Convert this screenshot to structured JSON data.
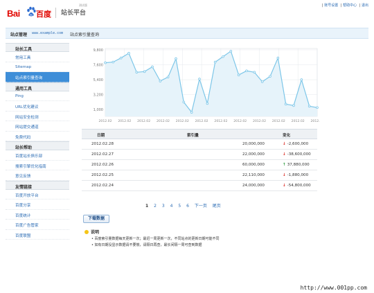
{
  "header": {
    "logo_bai": "Bai",
    "logo_du": "百度",
    "brand": "站长平台",
    "beta": "测试版",
    "toplinks": [
      "账号设置",
      "帮助中心",
      "退出"
    ],
    "sep": "|"
  },
  "titlebar": {
    "section": "站点管理",
    "site": "www.example.com",
    "page": "站点索引量查询"
  },
  "sidebar": {
    "groups": [
      {
        "title": "站长工具",
        "items": [
          "常用工具",
          "Sitemap",
          "站点索引量查询"
        ]
      },
      {
        "title": "通用工具",
        "items": [
          "Ping",
          "URL优化建议",
          "网站安全检测",
          "网站提交通道",
          "免费代码"
        ]
      },
      {
        "title": "站长帮助",
        "items": [
          "百度站长俱乐部",
          "搜索引擎优化指南",
          "意见反馈"
        ]
      },
      {
        "title": "友情链接",
        "items": [
          "百度开放平台",
          "百度分享",
          "百度统计",
          "百度广告管家",
          "百度联盟"
        ]
      }
    ]
  },
  "chart_data": {
    "type": "line",
    "ylim": [
      0,
      10000
    ],
    "yticks": [
      "1,000",
      "3,200",
      "5,400",
      "7,600",
      "9,800"
    ],
    "xticks": [
      "2012.02",
      "2012.02",
      "2012.02",
      "2012.02",
      "2012.02",
      "2012.02",
      "2012.02",
      "2012.02",
      "2012.02",
      "2012.02",
      "2012.02",
      "2012.02"
    ],
    "series": [
      {
        "values": [
          7900,
          8000,
          8600,
          9300,
          6500,
          6600,
          7300,
          5200,
          5800,
          8500,
          2100,
          600,
          5500,
          1900,
          8000,
          8800,
          9600,
          6100,
          6700,
          6500,
          5100,
          5900,
          8600,
          1800,
          1600,
          5400,
          1500,
          1300
        ]
      }
    ],
    "color": "#7cc6e8",
    "fill": "#e6f3fa",
    "grid": true
  },
  "table": {
    "headers": [
      "日期",
      "索引量",
      "变化"
    ],
    "rows": [
      {
        "date": "2012.02.28",
        "index": "20,000,000",
        "dir": "down",
        "change": "-2,600,000"
      },
      {
        "date": "2012.02.27",
        "index": "22,000,000",
        "dir": "down",
        "change": "-38,600,000"
      },
      {
        "date": "2012.02.26",
        "index": "60,000,000",
        "dir": "up",
        "change": "37,880,000"
      },
      {
        "date": "2012.02.25",
        "index": "22,110,000",
        "dir": "down",
        "change": "-1,880,000"
      },
      {
        "date": "2012.02.24",
        "index": "24,000,000",
        "dir": "down",
        "change": "-54,800,000"
      }
    ]
  },
  "pager": {
    "pages": [
      "1",
      "2",
      "3",
      "4",
      "5",
      "6"
    ],
    "next": "下一页",
    "last": "尾页",
    "current": "1"
  },
  "download_label": "下载数据",
  "note": {
    "title": "说明",
    "lines": [
      "百度索引量数据每天更新一次；最迟一周更新一次，不同站点的更新日期可能不同",
      "如有日期没显示数据请不要慌，请隔日再查，最长间隔一周可查到数据"
    ]
  },
  "watermark": "http://www.001pp.com"
}
